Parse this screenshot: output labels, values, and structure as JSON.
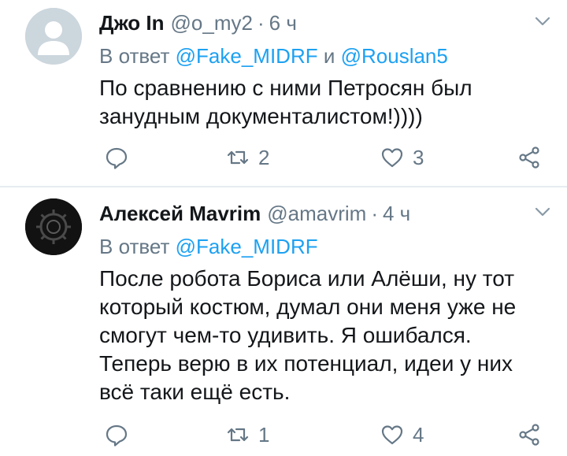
{
  "tweets": [
    {
      "name": "Джо In",
      "handle": "@o_my2",
      "dot": "·",
      "time": "6 ч",
      "reply_prefix": "В ответ",
      "mention_1": "@Fake_MIDRF",
      "reply_joiner": "и",
      "mention_2": "@Rouslan5",
      "text": "По сравнению с ними Петросян был занудным документалистом!))))",
      "retweets": "2",
      "likes": "3"
    },
    {
      "name": "Алексей Mavrim",
      "handle": "@amavrim",
      "dot": "·",
      "time": "4 ч",
      "reply_prefix": "В ответ",
      "mention_1": "@Fake_MIDRF",
      "text": "После робота Бориса или Алёши, ну тот который костюм, думал они меня уже не смогут чем-то удивить. Я ошибался. Теперь верю в их потенциал, идеи у них всё таки ещё есть.",
      "retweets": "1",
      "likes": "4"
    }
  ],
  "colors": {
    "accent": "#1da1f2",
    "secondary_text": "#657786",
    "primary_text": "#14171a",
    "divider": "#e6ecf0"
  },
  "icons": [
    "chevron-down-icon",
    "reply-icon",
    "retweet-icon",
    "heart-icon",
    "share-icon",
    "default-avatar-icon",
    "gear-avatar-icon"
  ]
}
